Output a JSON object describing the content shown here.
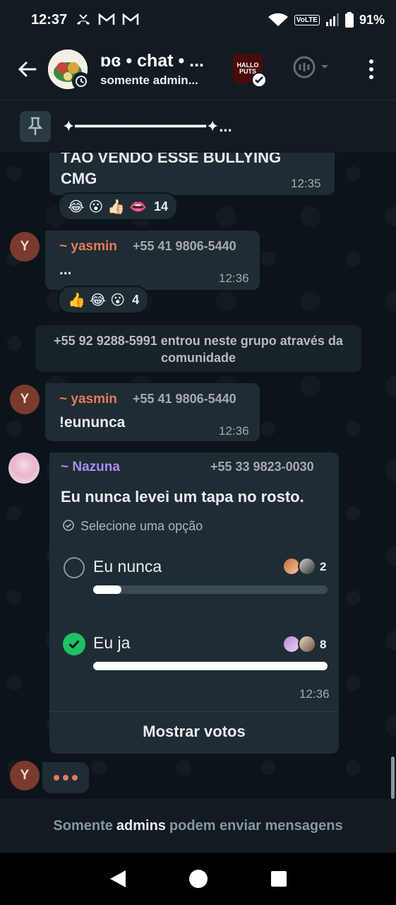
{
  "status_bar": {
    "time": "12:37",
    "battery": "91%",
    "volte": "VoLTE"
  },
  "header": {
    "title": "ɒɞ • chat • ...",
    "subtitle": "somente admin...",
    "community_label": "HALLO PUTS"
  },
  "pinned": {
    "text": "✦━━━━━━━━━━━━━━✦..."
  },
  "messages": [
    {
      "text": "TÃO VENDO ESSE BULLYING CMG",
      "time": "12:35",
      "reactions": [
        "😂",
        "😮",
        "👍🏻",
        "👄"
      ],
      "reaction_count": "14"
    },
    {
      "sender": "~ yasmin",
      "phone": "+55 41 9806-5440",
      "avatar_letter": "Y",
      "text": "...",
      "time": "12:36",
      "reactions": [
        "👍",
        "😂",
        "😮"
      ],
      "reaction_count": "4"
    },
    {
      "system": "+55 92 9288-5991 entrou neste grupo através da comunidade"
    },
    {
      "sender": "~ yasmin",
      "phone": "+55 41 9806-5440",
      "avatar_letter": "Y",
      "text": "!eununca",
      "time": "12:36"
    }
  ],
  "poll": {
    "sender": "~ Nazuna",
    "phone": "+55 33 9823-0030",
    "question": "Eu nunca levei um tapa no rosto.",
    "hint": "Selecione uma opção",
    "options": [
      {
        "label": "Eu nunca",
        "votes": "2",
        "fraction": 0.12,
        "selected": false
      },
      {
        "label": "Eu ja",
        "votes": "8",
        "fraction": 1.0,
        "selected": true
      }
    ],
    "time": "12:36",
    "show_votes": "Mostrar votos"
  },
  "typing": {
    "avatar_letter": "Y"
  },
  "footer": {
    "prefix": "Somente",
    "bold": "admins",
    "suffix": "podem enviar mensagens"
  },
  "colors": {
    "yasmin": "#e8795a",
    "nazuna": "#a78bfa",
    "check_green": "#21c063"
  }
}
